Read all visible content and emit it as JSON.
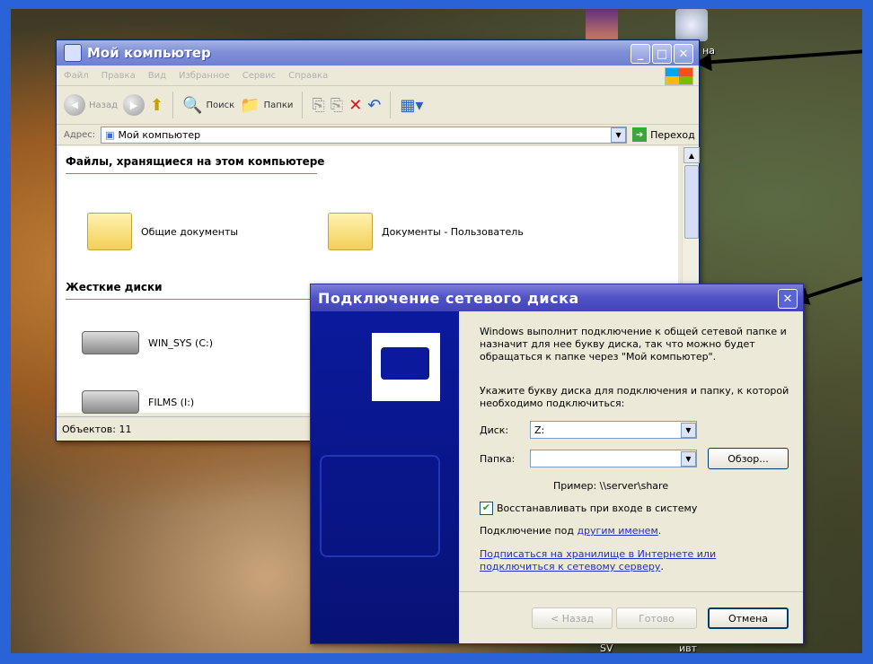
{
  "desktop": {
    "icon_labels": [
      "на",
      "SV",
      "ивт"
    ]
  },
  "explorer": {
    "title": "Мой компьютер",
    "menu": [
      "Файл",
      "Правка",
      "Вид",
      "Избранное",
      "Сервис",
      "Справка"
    ],
    "toolbar": {
      "back": "Назад",
      "search": "Поиск",
      "folders": "Папки"
    },
    "address_label": "Адрес:",
    "address_value": "Мой компьютер",
    "go_label": "Переход",
    "section_files": "Файлы, хранящиеся на этом компьютере",
    "folders": [
      "Общие документы",
      "Документы - Пользователь"
    ],
    "section_drives": "Жесткие диски",
    "drives": [
      "WIN_SYS (C:)",
      "FILMS (I:)"
    ],
    "status": "Объектов: 11"
  },
  "dialog": {
    "title": "Подключение сетевого диска",
    "intro": "Windows выполнит подключение к общей сетевой папке и назначит для нее букву диска, так что можно будет обращаться к папке через \"Мой компьютер\".",
    "instruction": "Укажите букву диска для подключения и папку, к которой необходимо подключиться:",
    "drive_label": "Диск:",
    "drive_value": "Z:",
    "folder_label": "Папка:",
    "folder_value": "",
    "browse_label": "Обзор...",
    "example": "Пример: \\\\server\\share",
    "reconnect_label": "Восстанавливать при входе в систему",
    "reconnect_checked": true,
    "connect_as_prefix": "Подключение под",
    "connect_as_link": "другим именем",
    "storage_link": "Подписаться на хранилище в Интернете или подключиться к сетевому серверу",
    "back_label": "< Назад",
    "finish_label": "Готово",
    "cancel_label": "Отмена"
  }
}
